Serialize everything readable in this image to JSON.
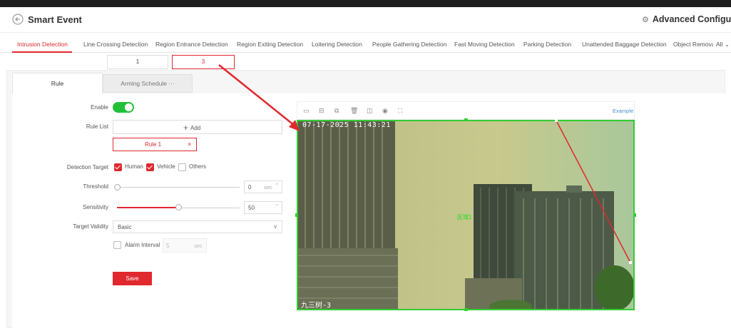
{
  "header": {
    "title": "Smart Event",
    "advanced_config": "Advanced Configuratio"
  },
  "tabs": [
    {
      "label": "Intrusion Detection",
      "active": true
    },
    {
      "label": "Line Crossing Detection"
    },
    {
      "label": "Region Entrance Detection"
    },
    {
      "label": "Region Exiting Detection"
    },
    {
      "label": "Loitering Detection"
    },
    {
      "label": "People Gathering Detection"
    },
    {
      "label": "Fast Moving Detection"
    },
    {
      "label": "Parking Detection"
    },
    {
      "label": "Unattended Baggage Detection"
    },
    {
      "label": "Object Remova"
    },
    {
      "label": "All"
    }
  ],
  "channels": [
    {
      "label": "1"
    },
    {
      "label": "3",
      "active": true
    }
  ],
  "subtabs": {
    "rule": "Rule",
    "arming_schedule": "Arming Schedule ···"
  },
  "form": {
    "enable_label": "Enable",
    "enable_on": true,
    "rule_list_label": "Rule List",
    "add_label": "Add",
    "rule_item": "Rule 1",
    "detection_target_label": "Detection Target",
    "targets": {
      "human": "Human",
      "vehicle": "Vehicle",
      "others": "Others"
    },
    "targets_checked": {
      "human": true,
      "vehicle": true,
      "others": false
    },
    "threshold_label": "Threshold",
    "threshold_value": "0",
    "threshold_unit": "sec",
    "sensitivity_label": "Sensitivity",
    "sensitivity_value": "50",
    "target_validity_label": "Target Validity",
    "target_validity_value": "Basic",
    "alarm_interval_label": "Alarm Interval",
    "alarm_interval_value": "5",
    "alarm_interval_unit": "sec",
    "save_label": "Save"
  },
  "video": {
    "example_label": "Example",
    "osd_time": "07-17-2025 11:43:21",
    "osd_name": "九三树-3",
    "region_label": "区域1"
  },
  "colors": {
    "accent": "#e0282e",
    "toggle_on": "#21c038",
    "region_border": "#33cc33",
    "link": "#4a8fd6"
  }
}
